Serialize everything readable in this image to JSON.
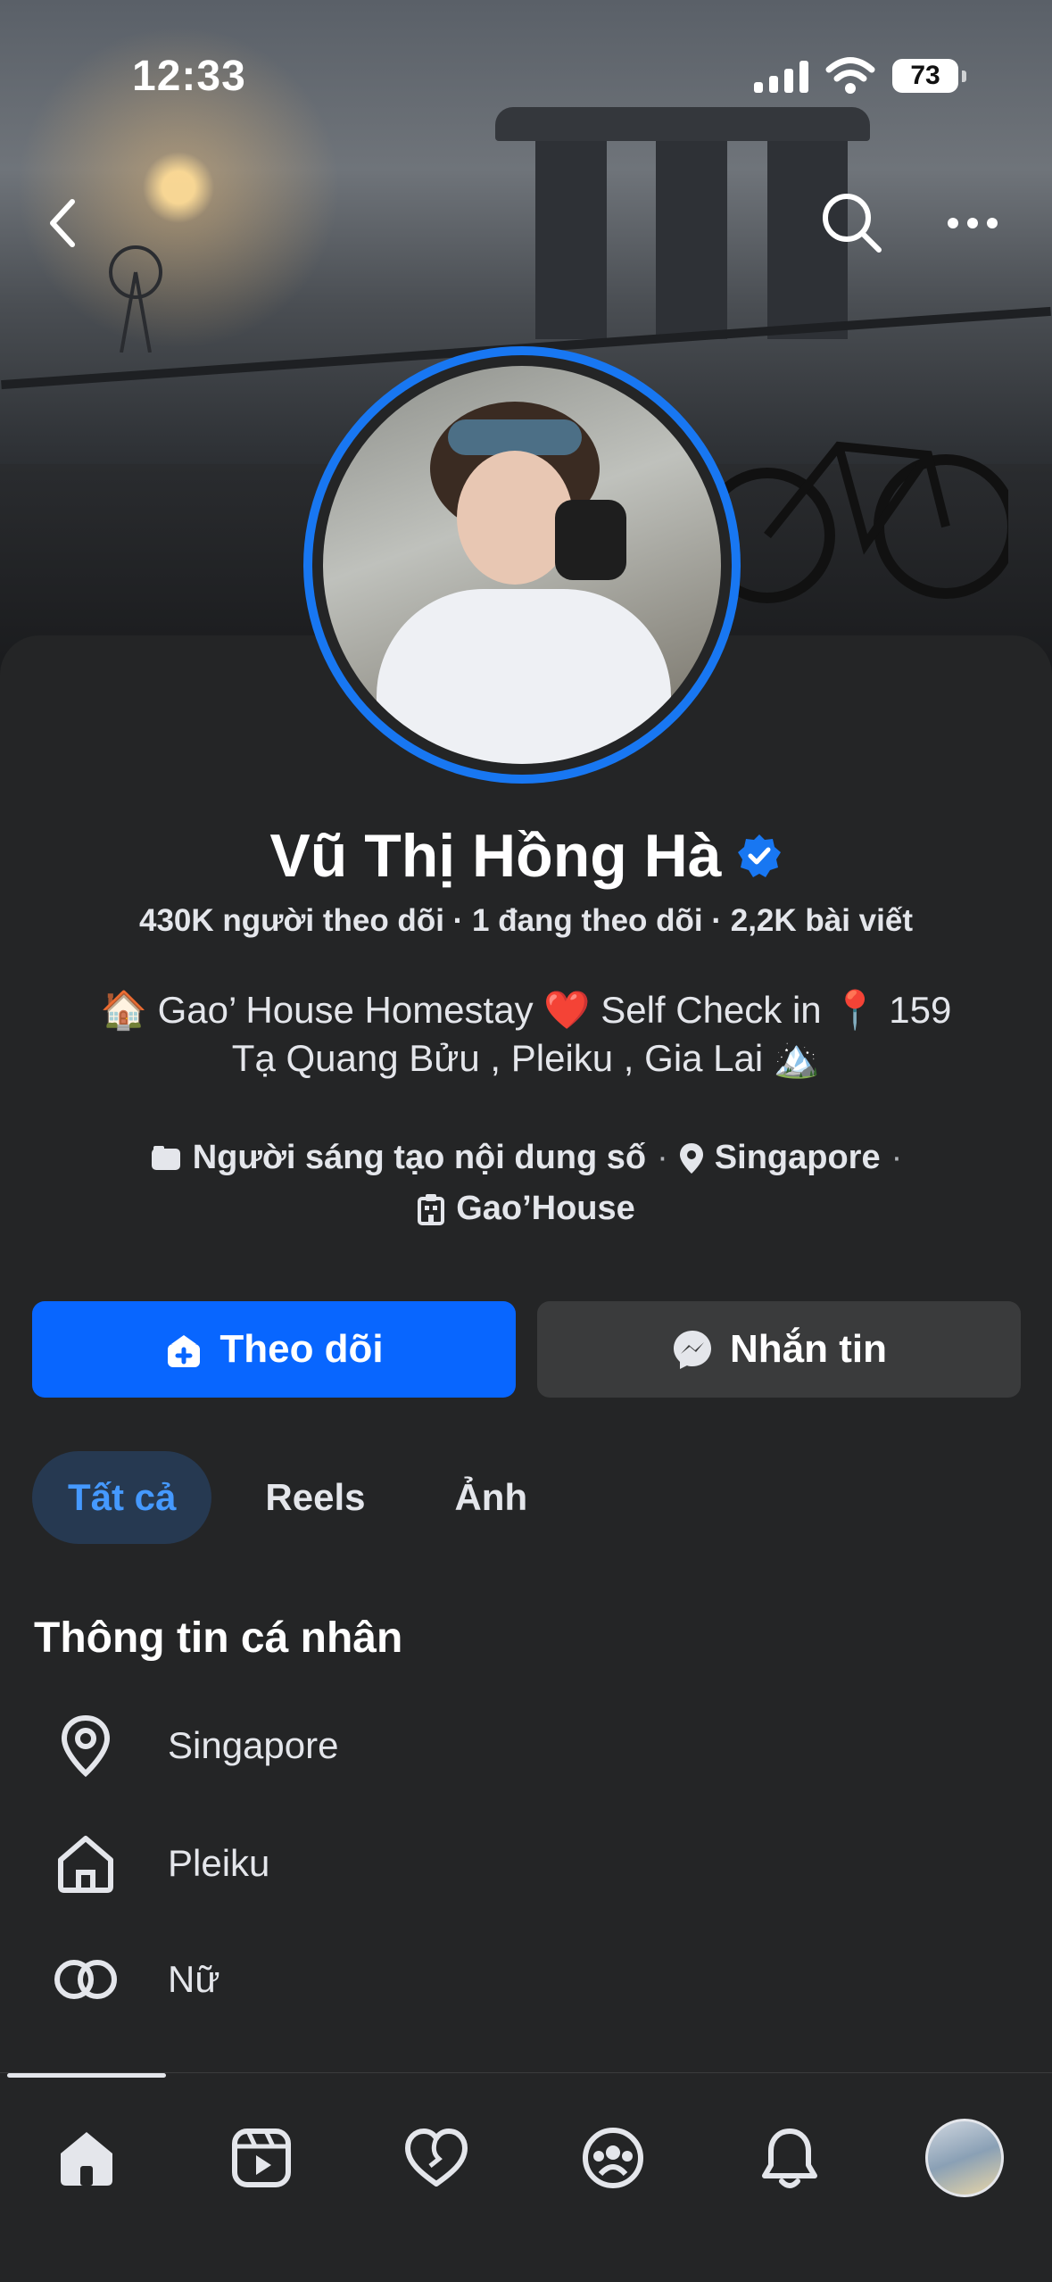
{
  "status_bar": {
    "time": "12:33",
    "battery": "73"
  },
  "profile": {
    "name": "Vũ Thị Hồng Hà",
    "stats": "430K người theo dõi · 1 đang theo dõi · 2,2K bài viết",
    "bio_line1": "🏠 Gao’ House Homestay ❤️ Self Check in 📍 159",
    "bio_line2": "Tạ Quang Bửu , Pleiku , Gia Lai 🏔️",
    "category": "Người sáng tạo nội dung số",
    "location": "Singapore",
    "workplace": "Gao’House"
  },
  "actions": {
    "follow_label": "Theo dõi",
    "message_label": "Nhắn tin"
  },
  "tabs": [
    {
      "label": "Tất cả",
      "active": true
    },
    {
      "label": "Reels",
      "active": false
    },
    {
      "label": "Ảnh",
      "active": false
    }
  ],
  "personal_info": {
    "title": "Thông tin cá nhân",
    "items": [
      {
        "icon": "location-pin-icon",
        "text": "Singapore"
      },
      {
        "icon": "home-icon",
        "text": "Pleiku"
      },
      {
        "icon": "gender-icon",
        "text": "Nữ"
      }
    ]
  },
  "bottom_nav": [
    {
      "icon": "home-icon",
      "active": true
    },
    {
      "icon": "video-icon"
    },
    {
      "icon": "dating-heart-icon"
    },
    {
      "icon": "groups-icon"
    },
    {
      "icon": "bell-icon"
    },
    {
      "icon": "profile-avatar"
    }
  ],
  "colors": {
    "accent": "#0866ff",
    "verified": "#1877f2",
    "background": "#242526",
    "tab_active_bg": "#263951",
    "tab_active_text": "#4599ff"
  }
}
